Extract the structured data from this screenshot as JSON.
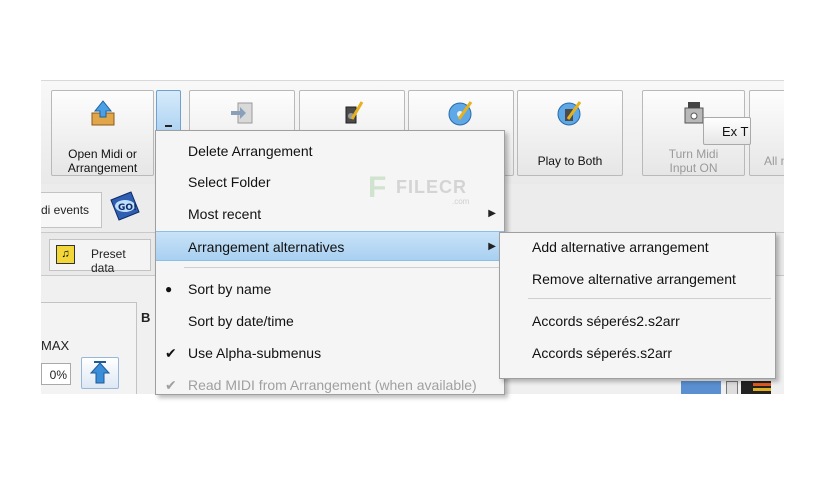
{
  "toolbar": {
    "open_label_1": "Open Midi or",
    "open_label_2": "Arrangement",
    "play_both": "Play to Both",
    "turn_midi_1": "Turn Midi",
    "turn_midi_2": "Input ON",
    "all_partial": "All n"
  },
  "tabs": {
    "events_partial": "di events",
    "ext_partial": "Ex T",
    "preset": "Preset data"
  },
  "left_panel": {
    "max_label": "MAX",
    "percent": "0%",
    "b_partial": "B"
  },
  "watermark": {
    "text": "FILECR",
    "sub": ".com"
  },
  "menu": {
    "items": [
      {
        "label": "Delete Arrangement"
      },
      {
        "label": "Select Folder"
      },
      {
        "label": "Most recent"
      },
      {
        "label": "Arrangement alternatives"
      },
      {
        "label": "Sort by name"
      },
      {
        "label": "Sort by date/time"
      },
      {
        "label": "Use Alpha-submenus"
      },
      {
        "label": "Read MIDI from Arrangement (when available)"
      }
    ]
  },
  "submenu": {
    "items": [
      {
        "label": "Add alternative arrangement"
      },
      {
        "label": "Remove alternative arrangement"
      },
      {
        "label": "Accords séperés2.s2arr"
      },
      {
        "label": "Accords séperés.s2arr"
      }
    ]
  },
  "colors": {
    "highlight": "#a8d0f1",
    "menu_bg": "#f5f5f5",
    "toolbar_bg": "#ececec"
  }
}
